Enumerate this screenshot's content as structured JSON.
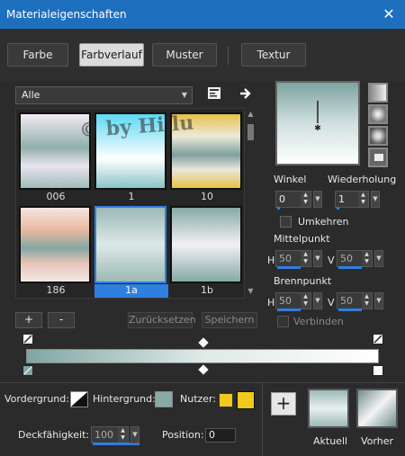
{
  "window": {
    "title": "Materialeigenschaften",
    "close_glyph": "✕"
  },
  "tabs": [
    {
      "label": "Farbe",
      "active": false
    },
    {
      "label": "Farbverlauf",
      "active": true
    },
    {
      "label": "Muster",
      "active": false
    },
    {
      "label": "Textur",
      "active": false
    }
  ],
  "library": {
    "category": "Alle",
    "thumbnails": [
      {
        "label": "006",
        "selected": false
      },
      {
        "label": "1",
        "selected": false
      },
      {
        "label": "10",
        "selected": false
      },
      {
        "label": "186",
        "selected": false
      },
      {
        "label": "1a",
        "selected": true
      },
      {
        "label": "1b",
        "selected": false
      }
    ],
    "add_label": "+",
    "remove_label": "-",
    "reset_label": "Zurücksetzen",
    "save_label": "Speichern"
  },
  "settings": {
    "winkel_label": "Winkel",
    "winkel_value": "0",
    "wiederholung_label": "Wiederholung",
    "wiederholung_value": "1",
    "umkehren_label": "Umkehren",
    "mittelpunkt_label": "Mittelpunkt",
    "mittel_h_label": "H",
    "mittel_h_value": "50",
    "mittel_v_label": "V",
    "mittel_v_value": "50",
    "brennpunkt_label": "Brennpunkt",
    "brenn_h_label": "H",
    "brenn_h_value": "50",
    "brenn_v_label": "V",
    "brenn_v_value": "50",
    "verbinden_label": "Verbinden"
  },
  "bottom": {
    "vordergrund_label": "Vordergrund:",
    "hintergrund_label": "Hintergrund:",
    "nutzer_label": "Nutzer:",
    "deckfaehigkeit_label": "Deckfähigkeit:",
    "deckfaehigkeit_value": "100",
    "position_label": "Position:",
    "position_value": "0",
    "plus_label": "+",
    "aktuell_label": "Aktuell",
    "vorher_label": "Vorher"
  },
  "watermark": "© by Hillu",
  "colors": {
    "accent": "#2f7fe0",
    "title_bar": "#1f6fbf",
    "swatch_yellow": "#f2c81c"
  }
}
